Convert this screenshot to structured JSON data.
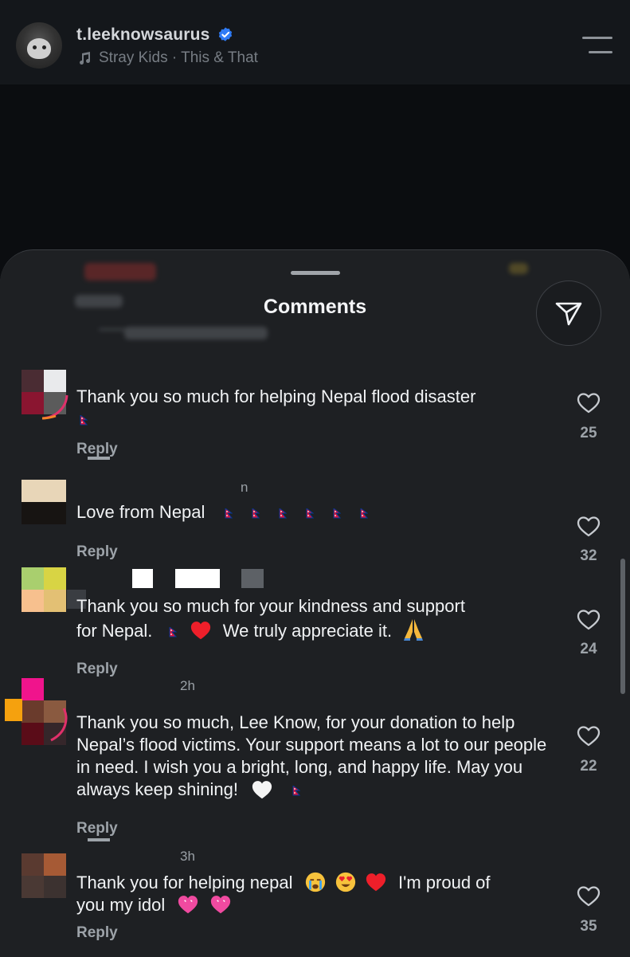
{
  "header": {
    "username": "t.leeknowsaurus",
    "verified": true,
    "music": "Stray Kids · This & That",
    "icons": {
      "menu": "menu-icon",
      "music": "music-note-icon",
      "verified": "verified-badge-icon"
    }
  },
  "sheet": {
    "title": "Comments",
    "share_icon": "send-icon"
  },
  "comments": [
    {
      "meta_time": "",
      "text": "Thank you so much for helping Nepal flood disaster",
      "reply_label": "Reply",
      "likes": "25",
      "emojis": [
        "nepal-flag"
      ]
    },
    {
      "meta_time": "n",
      "text": "Love from Nepal",
      "reply_label": "Reply",
      "likes": "32",
      "emojis": [
        "nepal-flag",
        "nepal-flag",
        "nepal-flag",
        "nepal-flag",
        "nepal-flag",
        "nepal-flag"
      ]
    },
    {
      "meta_time": "",
      "text_line1": "Thank you so much for your kindness and support",
      "text_line2a": "for Nepal.",
      "text_line2b": "We truly appreciate it.",
      "reply_label": "Reply",
      "likes": "24",
      "emojis": [
        "nepal-flag",
        "red-heart",
        "folded-hands"
      ]
    },
    {
      "meta_time": "2h",
      "text_main": "Thank you so much, Lee Know, for your donation to help Nepal’s flood victims. Your support means a lot to our people in need. I wish you a bright, long, and happy life. May you always keep shining!",
      "reply_label": "Reply",
      "likes": "22",
      "emojis": [
        "white-heart",
        "nepal-flag"
      ]
    },
    {
      "meta_time": "3h",
      "text_part1": "Thank you for helping nepal",
      "text_part2": "I'm proud of",
      "text_part3": "you my idol",
      "reply_label": "Reply",
      "likes": "35",
      "emojis": [
        "crying-face",
        "heart-eyes",
        "red-heart",
        "pink-heart",
        "pink-heart"
      ]
    }
  ],
  "colors": {
    "background": "#0b0d10",
    "sheet": "#1e2023",
    "text": "#f1f3f5",
    "muted": "#9da3a9",
    "nepal_red": "#dc143c",
    "nepal_blue": "#003893"
  }
}
